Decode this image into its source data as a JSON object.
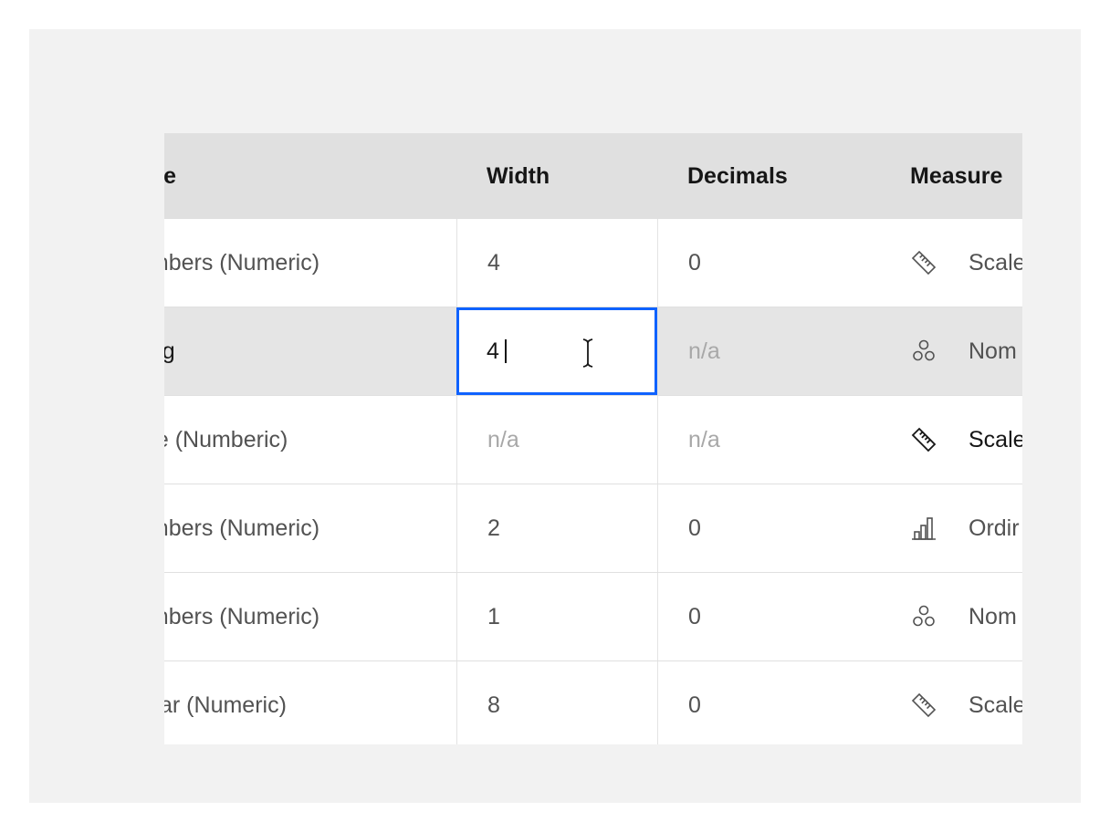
{
  "columns": {
    "type": "ype",
    "width": "Width",
    "decimals": "Decimals",
    "measure": "Measure"
  },
  "rows": [
    {
      "type": "umbers (Numeric)",
      "width": "4",
      "decimals": "0",
      "measure_icon": "ruler-icon",
      "measure": "Scale"
    },
    {
      "type": "ring",
      "width": "4",
      "decimals": "n/a",
      "measure_icon": "nominal-circles-icon",
      "measure": "Nom"
    },
    {
      "type": "ate (Numberic)",
      "width": "n/a",
      "decimals": "n/a",
      "measure_icon": "ruler-icon",
      "measure": "Scale"
    },
    {
      "type": "umbers (Numeric)",
      "width": "2",
      "decimals": "0",
      "measure_icon": "ordinal-bars-icon",
      "measure": "Ordir"
    },
    {
      "type": "umbers (Numeric)",
      "width": "1",
      "decimals": "0",
      "measure_icon": "nominal-circles-icon",
      "measure": "Nom"
    },
    {
      "type": "ollar (Numeric)",
      "width": "8",
      "decimals": "0",
      "measure_icon": "ruler-icon",
      "measure": "Scale"
    }
  ],
  "colors": {
    "header_bg": "#e0e0e0",
    "selected_row_bg": "#e5e5e5",
    "focus_border": "#0f62fe",
    "panel_bg": "#f2f2f2"
  }
}
